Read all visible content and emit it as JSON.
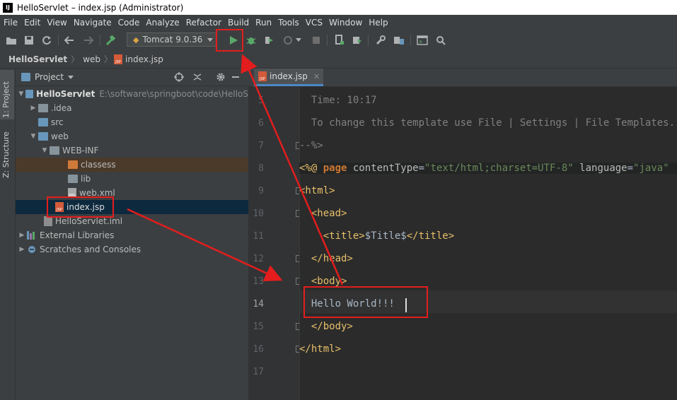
{
  "window": {
    "title": "HelloServlet – index.jsp (Administrator)",
    "logo": "IJ"
  },
  "menu": [
    "File",
    "Edit",
    "View",
    "Navigate",
    "Code",
    "Analyze",
    "Refactor",
    "Build",
    "Run",
    "Tools",
    "VCS",
    "Window",
    "Help"
  ],
  "toolbar": {
    "run_config": "Tomcat 9.0.36"
  },
  "breadcrumb": [
    "HelloServlet",
    "web",
    "index.jsp"
  ],
  "side_tabs": {
    "project": "1: Project",
    "structure": "Z: Structure"
  },
  "project": {
    "header": "Project",
    "root": {
      "name": "HelloServlet",
      "path": "E:\\software\\springboot\\code\\HelloS"
    },
    "items": [
      {
        "label": ".idea"
      },
      {
        "label": "src"
      },
      {
        "label": "web"
      },
      {
        "label": "WEB-INF"
      },
      {
        "label": "classess"
      },
      {
        "label": "lib"
      },
      {
        "label": "web.xml"
      },
      {
        "label": "index.jsp"
      },
      {
        "label": "HelloServlet.iml"
      },
      {
        "label": "External Libraries"
      },
      {
        "label": "Scratches and Consoles"
      }
    ]
  },
  "editor": {
    "tab": "index.jsp",
    "line_numbers": [
      "5",
      "6",
      "7",
      "8",
      "9",
      "10",
      "11",
      "12",
      "13",
      "14",
      "15",
      "16",
      "17"
    ],
    "lines": {
      "l5": "  Time: 10:17",
      "l6": "  To change this template use File | Settings | File Templates.",
      "l7": "--%>",
      "l8_a": "<%@ ",
      "l8_b": "page ",
      "l8_c": "contentType",
      "l8_d": "=",
      "l8_e": "\"text/html;charset=UTF-8\"",
      "l8_f": " language",
      "l8_g": "=",
      "l8_h": "\"java\"",
      "l9": "<html>",
      "l10": "  <head>",
      "l11_a": "    <title>",
      "l11_b": "$Title$",
      "l11_c": "</title>",
      "l12": "  </head>",
      "l13": "  <body>",
      "l14": "  Hello World!!!",
      "l15": "  </body>",
      "l16": "</html>"
    }
  },
  "colors": {
    "annotation": "#e31d1d",
    "run_green": "#59a869"
  }
}
